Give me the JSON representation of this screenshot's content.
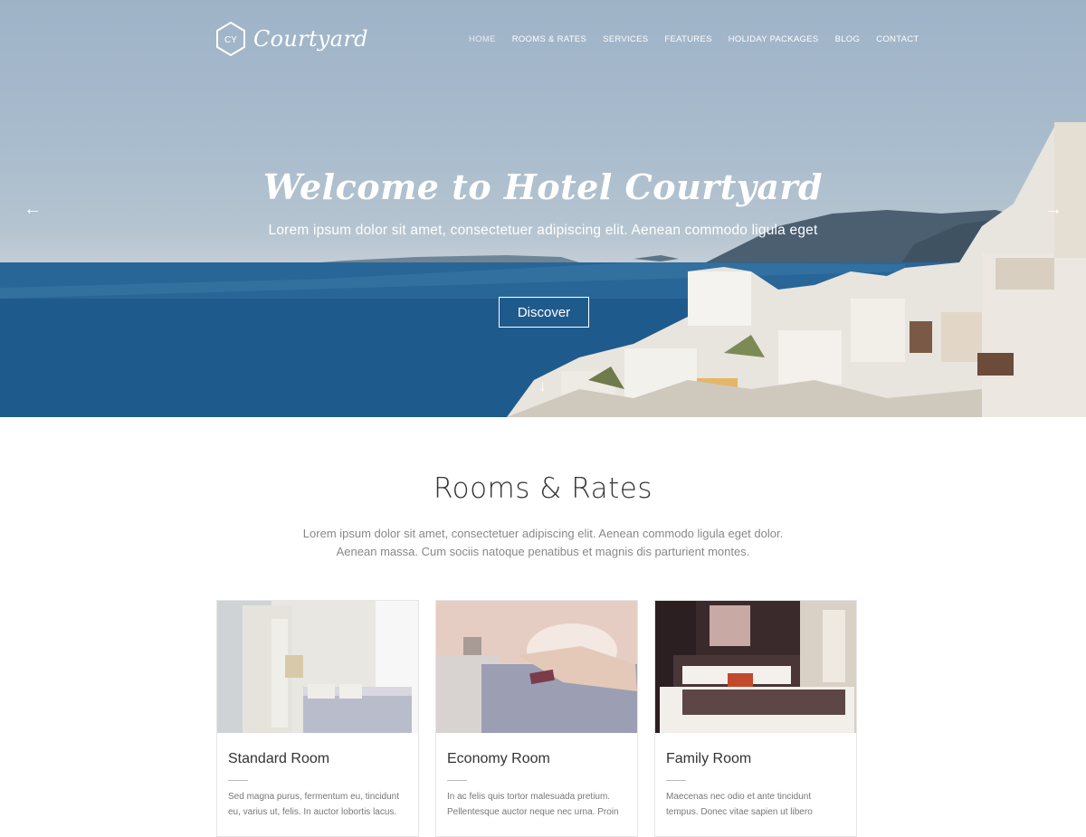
{
  "header": {
    "logo_badge": "CY",
    "logo_text": "Courtyard",
    "nav": [
      "HOME",
      "ROOMS & RATES",
      "SERVICES",
      "FEATURES",
      "HOLIDAY PACKAGES",
      "BLOG",
      "CONTACT"
    ]
  },
  "hero": {
    "title": "Welcome to Hotel Courtyard",
    "subtitle": "Lorem ipsum dolor sit amet, consectetuer adipiscing elit. Aenean commodo ligula eget",
    "button": "Discover",
    "icons": {
      "prev": "arrow-left-icon",
      "next": "arrow-right-icon",
      "down": "arrow-down-icon"
    }
  },
  "rooms": {
    "title": "Rooms & Rates",
    "desc_line1": "Lorem ipsum dolor sit amet, consectetuer adipiscing elit. Aenean commodo ligula eget dolor.",
    "desc_line2": "Aenean massa. Cum sociis natoque penatibus et magnis dis parturient montes.",
    "cards": [
      {
        "name": "Standard Room",
        "line1": "Sed magna purus, fermentum eu, tincidunt",
        "line2": "eu, varius ut, felis. In auctor lobortis lacus."
      },
      {
        "name": "Economy Room",
        "line1": "In ac felis quis tortor malesuada pretium.",
        "line2": "Pellentesque auctor neque nec urna. Proin"
      },
      {
        "name": "Family Room",
        "line1": "Maecenas nec odio et ante tincidunt",
        "line2": "tempus. Donec vitae sapien ut libero"
      }
    ]
  },
  "colors": {
    "sea": "#1f5688",
    "sky": "#a9bccd",
    "text": "#333333",
    "muted": "#888888"
  }
}
